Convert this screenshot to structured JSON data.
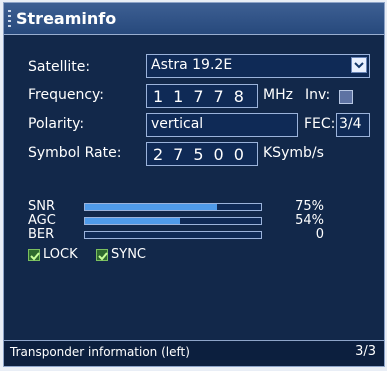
{
  "window": {
    "title": "Streaminfo"
  },
  "fields": {
    "satellite": {
      "label": "Satellite:",
      "value": "Astra 19.2E"
    },
    "frequency": {
      "label": "Frequency:",
      "value": "11778",
      "unit": "MHz",
      "inv_label": "Inv:"
    },
    "polarity": {
      "label": "Polarity:",
      "value": "vertical",
      "fec_label": "FEC:",
      "fec_value": "3/4"
    },
    "symbol_rate": {
      "label": "Symbol Rate:",
      "value": "27500",
      "unit": "KSymb/s"
    }
  },
  "signal": {
    "snr": {
      "label": "SNR",
      "value": "75%",
      "level": 0.75
    },
    "agc": {
      "label": "AGC",
      "value": "54%",
      "level": 0.54
    },
    "ber": {
      "label": "BER",
      "value": "0",
      "level": 0
    }
  },
  "status_flags": {
    "lock": {
      "label": "LOCK",
      "checked": true
    },
    "sync": {
      "label": "SYNC",
      "checked": true
    }
  },
  "statusbar": {
    "text": "Transponder information (left)",
    "page": "3/3"
  },
  "icons": {
    "dropdown": "chevron-down-icon",
    "grip": "grip-icon",
    "check": "checkmark-icon"
  }
}
